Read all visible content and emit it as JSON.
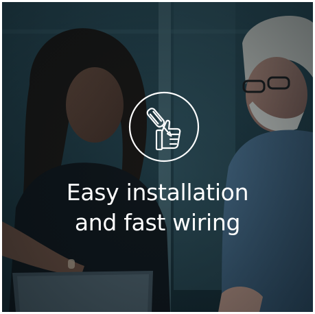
{
  "hero": {
    "headline_line1": "Easy installation",
    "headline_line2": "and fast wiring",
    "icon": "screwdriver-thumbs-up-icon"
  },
  "colors": {
    "overlay": "#14262f",
    "text": "#ffffff"
  }
}
